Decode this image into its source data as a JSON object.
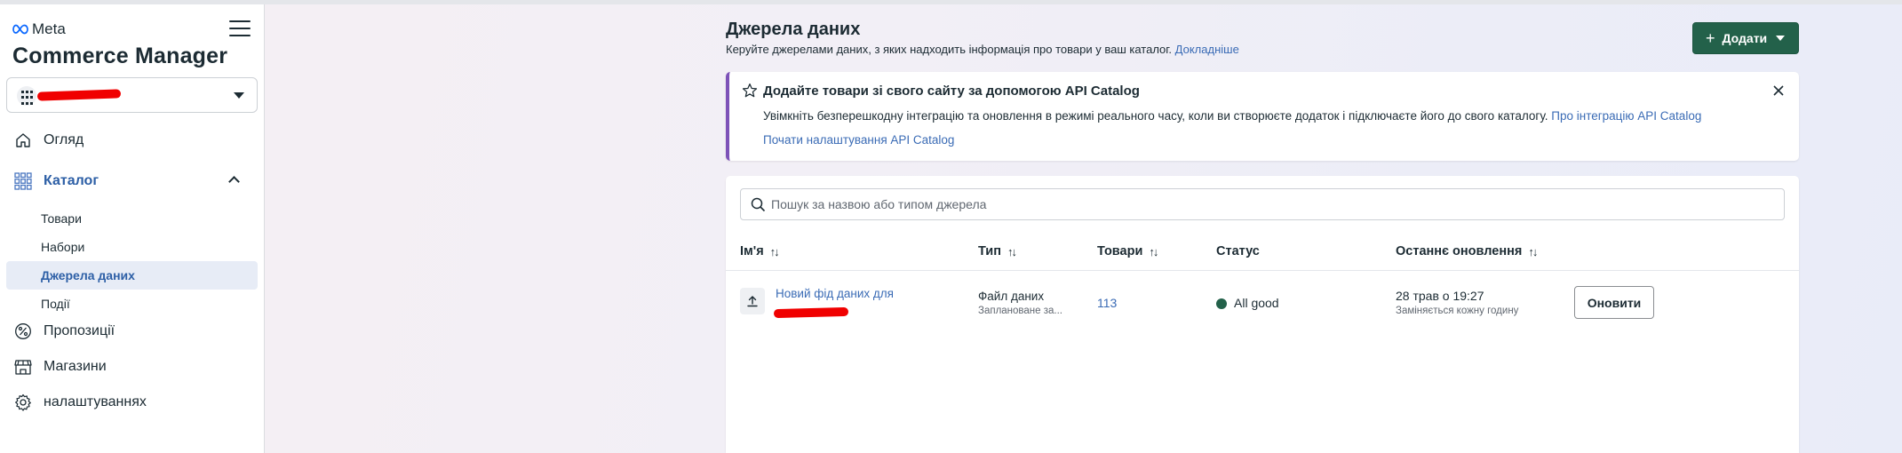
{
  "app": {
    "brand": "Meta",
    "title": "Commerce Manager"
  },
  "sidebar": {
    "nav": [
      {
        "label": "Огляд",
        "icon": "home-icon"
      },
      {
        "label": "Каталог",
        "icon": "grid-icon",
        "expanded": true
      },
      {
        "label": "Пропозиції",
        "icon": "percent-icon"
      },
      {
        "label": "Магазини",
        "icon": "storefront-icon"
      },
      {
        "label": "налаштуваннях",
        "icon": "gear-icon"
      }
    ],
    "catalog_sub": [
      {
        "label": "Товари"
      },
      {
        "label": "Набори"
      },
      {
        "label": "Джерела даних",
        "active": true
      },
      {
        "label": "Події"
      }
    ]
  },
  "header": {
    "title": "Джерела даних",
    "subtitle": "Керуйте джерелами даних, з яких надходить інформація про товари у ваш каталог.",
    "learn_more": "Докладніше",
    "add_button": "Додати"
  },
  "banner": {
    "title": "Додайте товари зі свого сайту за допомогою API Catalog",
    "text": "Увімкніть безперешкодну інтеграцію та оновлення в режимі реального часу, коли ви створюєте додаток і підключаєте його до свого каталогу.",
    "link1": "Про інтеграцію API Catalog",
    "link2": "Почати налаштування API Catalog",
    "accent": "#7d52b8"
  },
  "table": {
    "search_placeholder": "Пошук за назвою або типом джерела",
    "columns": [
      "Ім'я",
      "Тип",
      "Товари",
      "Статус",
      "Останнє оновлення"
    ],
    "sort_glyph": "↑↓",
    "rows": [
      {
        "name": "Новий фід даних для",
        "type": "Файл даних",
        "type_sub": "Заплановане за...",
        "items": "113",
        "status": "All good",
        "status_color": "#23614a",
        "updated": "28 трав о 19:27",
        "updated_sub": "Заміняється кожну годину",
        "action": "Оновити"
      }
    ]
  },
  "colors": {
    "primary_button": "#23614a",
    "link": "#3a6bb5",
    "active_nav": "#2d5fa6"
  }
}
